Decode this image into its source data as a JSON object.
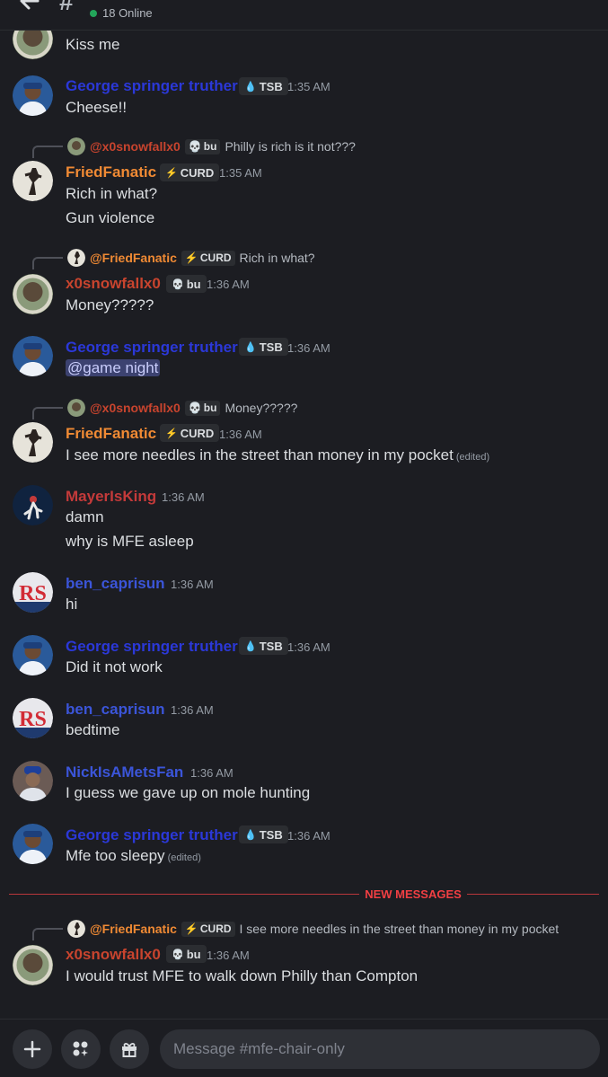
{
  "header": {
    "online_text": "18 Online"
  },
  "colors": {
    "george": "#2b38d8",
    "fried": "#f08a34",
    "snow": "#c8442e",
    "mayer": "#c43a3a",
    "ben": "#3b55d9",
    "nick": "#3b55d9",
    "mention": "#c9cdfb",
    "new_messages": "#f23f43"
  },
  "messages": [
    {
      "text": "Kiss me"
    },
    {
      "author": "George springer truther",
      "tag": "TSB",
      "tag_icon": "droplet-icon",
      "time": "1:35 AM",
      "lines": [
        "Cheese!!"
      ]
    },
    {
      "reply_author": "@x0snowfallx0",
      "reply_tag": "bu",
      "reply_text": "Philly is rich is it not???",
      "author": "FriedFanatic",
      "tag": "CURD",
      "tag_icon": "lightning-icon",
      "time": "1:35 AM",
      "lines": [
        "Rich in what?",
        "Gun violence"
      ]
    },
    {
      "reply_author": "@FriedFanatic",
      "reply_tag": "CURD",
      "reply_text": "Rich in what?",
      "author": "x0snowfallx0",
      "tag": "bu",
      "tag_icon": "skull-icon",
      "time": "1:36 AM",
      "lines": [
        "Money?????"
      ]
    },
    {
      "author": "George springer truther",
      "tag": "TSB",
      "time": "1:36 AM",
      "mention": "@game night"
    },
    {
      "reply_author": "@x0snowfallx0",
      "reply_tag": "bu",
      "reply_text": "Money?????",
      "author": "FriedFanatic",
      "tag": "CURD",
      "time": "1:36 AM",
      "lines": [
        "I see more needles in the street than money in my pocket"
      ],
      "edited": "(edited)"
    },
    {
      "author": "MayerIsKing",
      "time": "1:36 AM",
      "lines": [
        "damn",
        "why is MFE asleep"
      ]
    },
    {
      "author": "ben_caprisun",
      "time": "1:36 AM",
      "lines": [
        "hi"
      ]
    },
    {
      "author": "George springer truther",
      "tag": "TSB",
      "time": "1:36 AM",
      "lines": [
        "Did it not work"
      ]
    },
    {
      "author": "ben_caprisun",
      "time": "1:36 AM",
      "lines": [
        "bedtime"
      ]
    },
    {
      "author": "NickIsAMetsFan",
      "time": "1:36 AM",
      "lines": [
        "I guess we gave up on mole hunting"
      ]
    },
    {
      "author": "George springer truther",
      "tag": "TSB",
      "time": "1:36 AM",
      "lines": [
        "Mfe too sleepy"
      ],
      "edited": "(edited)"
    },
    {
      "reply_author": "@FriedFanatic",
      "reply_tag": "CURD",
      "reply_text": "I see more needles in the street than money in my pocket",
      "author": "x0snowfallx0",
      "tag": "bu",
      "time": "1:36 AM",
      "lines": [
        "I would trust MFE to walk down Philly than Compton"
      ]
    }
  ],
  "new_messages_label": "NEW MESSAGES",
  "composer": {
    "placeholder": "Message #mfe-chair-only"
  }
}
